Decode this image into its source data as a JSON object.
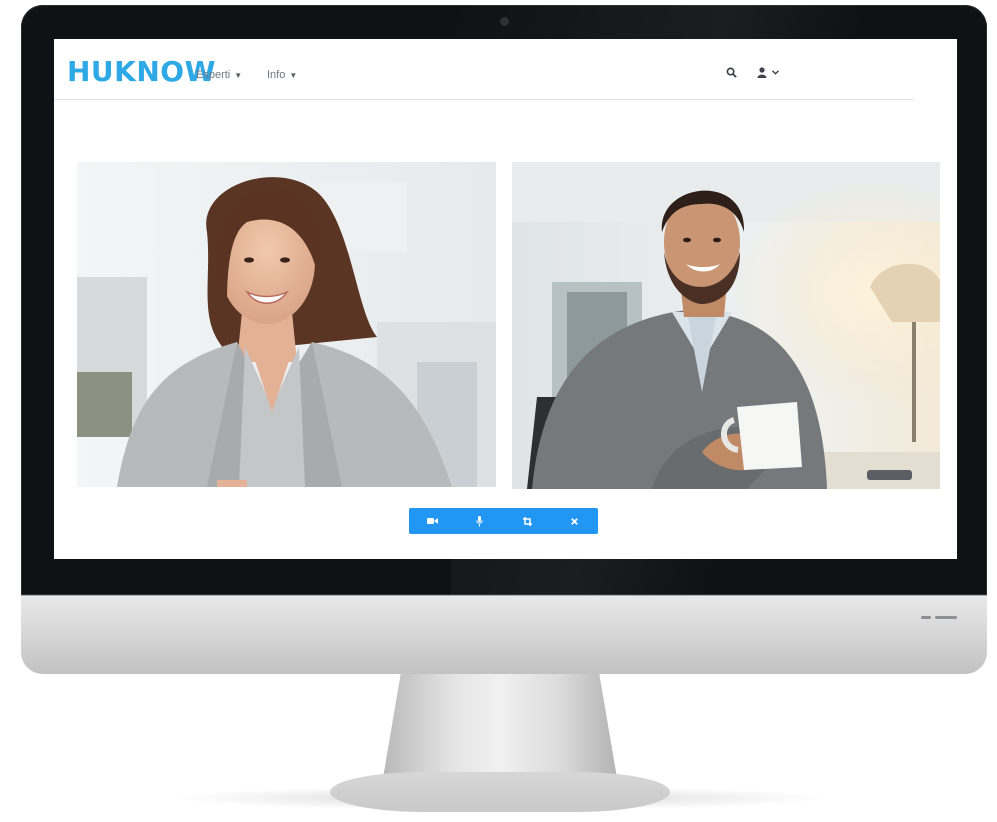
{
  "brand": {
    "logo_text": "HUKNOW",
    "accent_color": "#2ea9e6"
  },
  "nav": {
    "items": [
      {
        "label": "Esperti",
        "icon": "chevron-down-icon"
      },
      {
        "label": "Info",
        "icon": "chevron-down-icon"
      }
    ],
    "right": [
      {
        "icon": "search-icon"
      },
      {
        "icon": "user-icon",
        "dropdown": "chevron-down-icon"
      }
    ]
  },
  "videos": [
    {
      "participant": "woman in grey blazer",
      "icon": "video-feed"
    },
    {
      "participant": "man holding coffee cup",
      "icon": "video-feed"
    }
  ],
  "call_controls": {
    "bar_color": "#2196f3",
    "buttons": [
      {
        "icon": "video-camera-icon"
      },
      {
        "icon": "microphone-icon"
      },
      {
        "icon": "crop-icon"
      },
      {
        "icon": "close-icon"
      }
    ]
  }
}
